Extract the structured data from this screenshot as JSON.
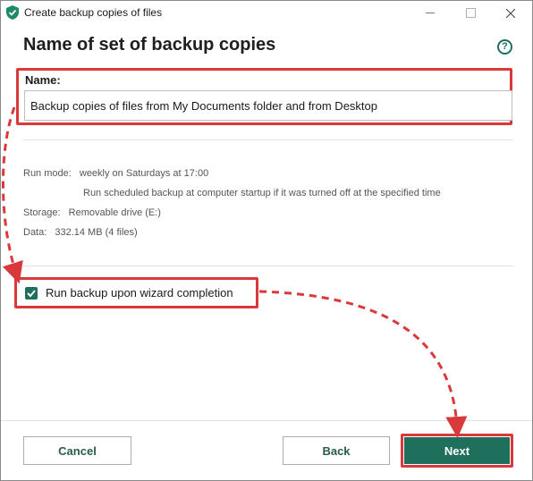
{
  "window": {
    "title": "Create backup copies of files",
    "controls": [
      "minimize",
      "maximize",
      "close"
    ]
  },
  "page": {
    "title": "Name of set of backup copies",
    "help_icon": "?"
  },
  "name_field": {
    "label": "Name:",
    "value": "Backup copies of files from My Documents folder and from Desktop"
  },
  "summary": {
    "run_mode_label": "Run mode:",
    "run_mode_value": "weekly on Saturdays at 17:00",
    "run_mode_note": "Run scheduled backup at computer startup if it was turned off at the specified time",
    "storage_label": "Storage:",
    "storage_value": "Removable drive (E:)",
    "data_label": "Data:",
    "data_value": "332.14 MB (4 files)"
  },
  "checkbox": {
    "label": "Run backup upon wizard completion",
    "checked": true
  },
  "buttons": {
    "cancel": "Cancel",
    "back": "Back",
    "next": "Next"
  },
  "colors": {
    "accent": "#1e6f5c",
    "highlight": "#d9393b"
  }
}
